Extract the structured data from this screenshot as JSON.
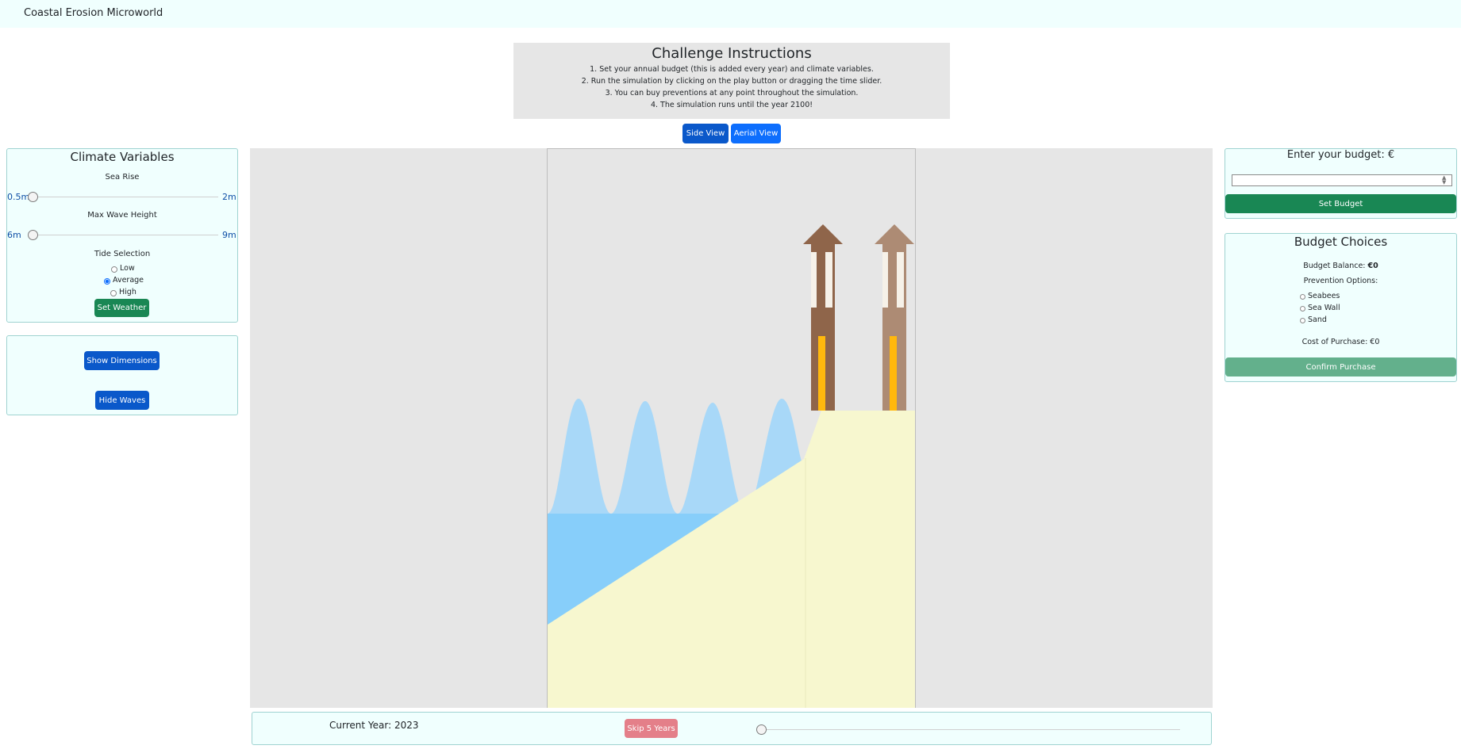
{
  "app": {
    "title": "Coastal Erosion Microworld"
  },
  "instructions": {
    "title": "Challenge Instructions",
    "steps": [
      "1. Set your annual budget (this is added every year) and climate variables.",
      "2. Run the simulation by clicking on the play button or dragging the time slider.",
      "3. You can buy preventions at any point throughout the simulation.",
      "4. The simulation runs until the year 2100!"
    ]
  },
  "view_toggle": {
    "side_label": "Side View",
    "aerial_label": "Aerial View"
  },
  "climate": {
    "title": "Climate Variables",
    "sea_rise": {
      "label": "Sea Rise",
      "min_label": "0.5m",
      "max_label": "2m"
    },
    "wave_height": {
      "label": "Max Wave Height",
      "min_label": "6m",
      "max_label": "9m"
    },
    "tide": {
      "label": "Tide Selection",
      "options": [
        "Low",
        "Average",
        "High"
      ],
      "selected": "Average"
    },
    "set_weather_label": "Set Weather"
  },
  "display": {
    "show_dimensions_label": "Show Dimensions",
    "hide_waves_label": "Hide Waves"
  },
  "budget": {
    "prompt": "Enter your budget: €",
    "input_value": "",
    "set_budget_label": "Set Budget"
  },
  "choices": {
    "title": "Budget Choices",
    "balance_label": "Budget Balance:",
    "balance_value": "€0",
    "prevention_label": "Prevention Options:",
    "options": [
      "Seabees",
      "Sea Wall",
      "Sand"
    ],
    "cost_text": "Cost of Purchase: €0",
    "confirm_label": "Confirm Purchase"
  },
  "timeline": {
    "current_year_text": "Current Year: 2023",
    "skip_label": "Skip 5 Years",
    "slider_fraction": 0
  },
  "colors": {
    "accent_blue": "#0d6efd",
    "green": "#198754",
    "sea": "#87cefa",
    "waves": "#a8d8f8",
    "sand": "#f7f7cf",
    "house_dark": "#8f654a",
    "house_light": "#ad8b74",
    "window_yellow": "#ffb80d"
  }
}
